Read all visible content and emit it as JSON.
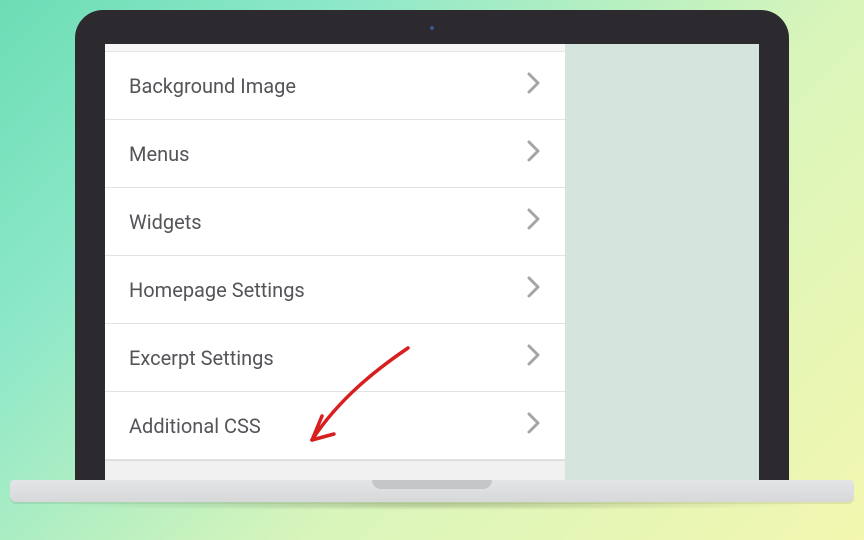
{
  "customizer": {
    "items": [
      {
        "label": "Background Image"
      },
      {
        "label": "Menus"
      },
      {
        "label": "Widgets"
      },
      {
        "label": "Homepage Settings"
      },
      {
        "label": "Excerpt Settings"
      },
      {
        "label": "Additional CSS"
      }
    ]
  }
}
